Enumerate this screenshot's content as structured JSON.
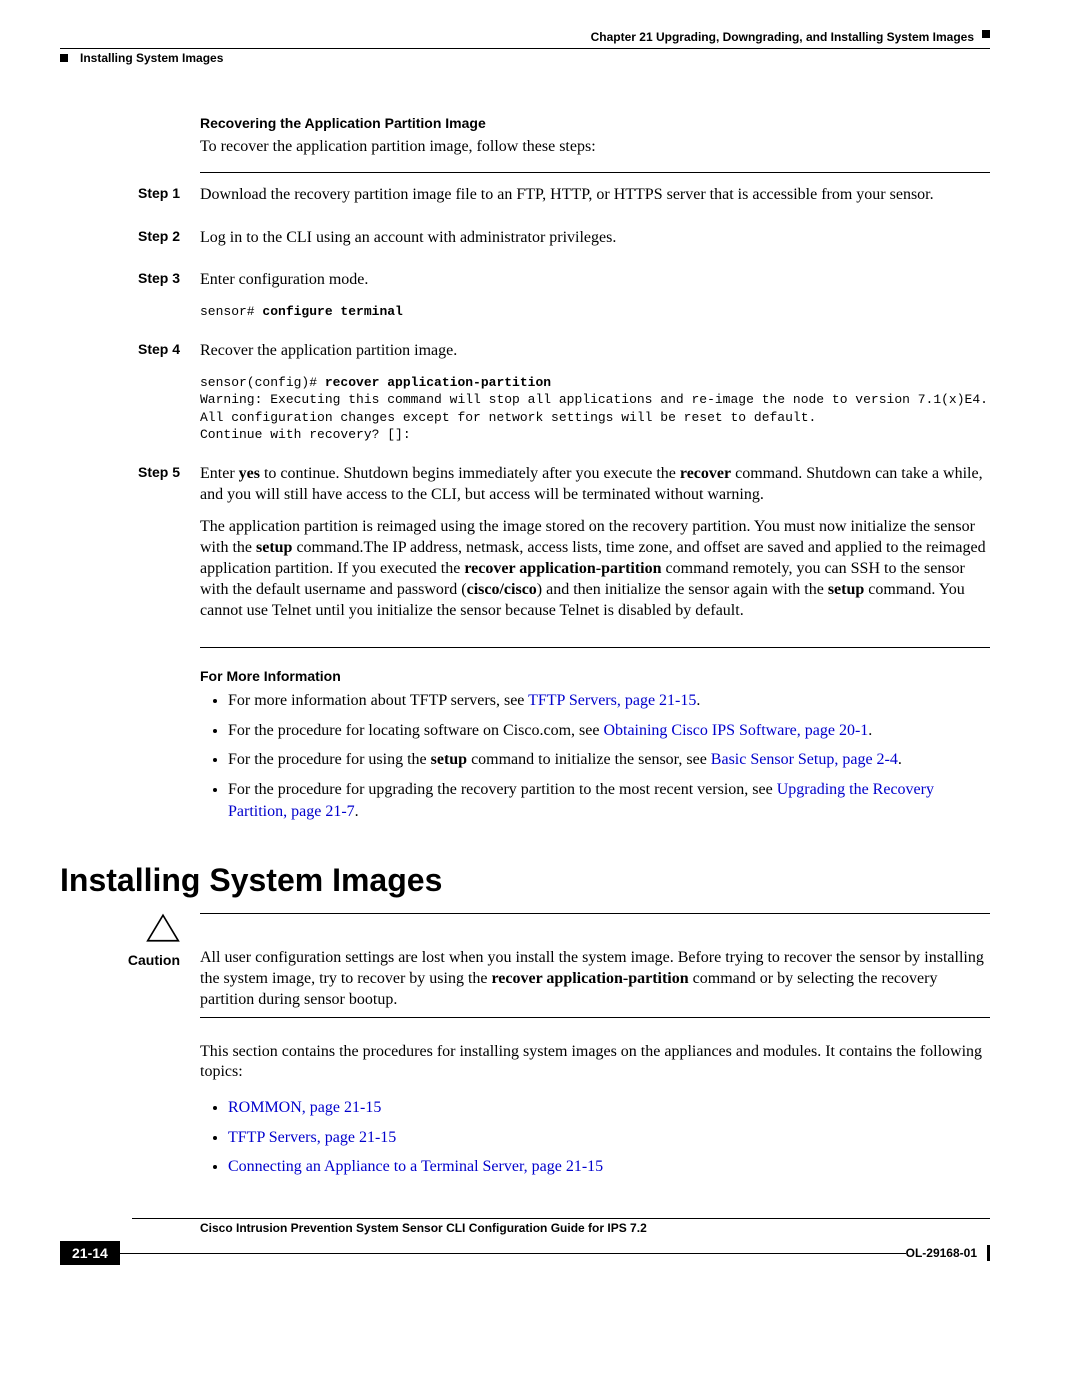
{
  "header": {
    "chapter": "Chapter 21    Upgrading, Downgrading, and Installing System Images",
    "section": "Installing System Images"
  },
  "recovering": {
    "heading": "Recovering the Application Partition Image",
    "intro": "To recover the application partition image, follow these steps:",
    "steps": {
      "s1": {
        "label": "Step 1",
        "text": "Download the recovery partition image file to an FTP, HTTP, or HTTPS server that is accessible from your sensor."
      },
      "s2": {
        "label": "Step 2",
        "text": "Log in to the CLI using an account with administrator privileges."
      },
      "s3": {
        "label": "Step 3",
        "text": "Enter configuration mode.",
        "code_prefix": "sensor# ",
        "code_bold": "configure terminal"
      },
      "s4": {
        "label": "Step 4",
        "text": "Recover the application partition image.",
        "code_prefix": "sensor(config)# ",
        "code_bold": "recover application-partition",
        "warning": "Warning: Executing this command will stop all applications and re-image the node to version 7.1(x)E4. All configuration changes except for network settings will be reset to default.\nContinue with recovery? []:"
      },
      "s5": {
        "label": "Step 5",
        "p1_pre": "Enter ",
        "p1_b1": "yes",
        "p1_mid1": " to continue. Shutdown begins immediately after you execute the ",
        "p1_b2": "recover",
        "p1_post": " command. Shutdown can take a while, and you will still have access to the CLI, but access will be terminated without warning.",
        "p2_pre": "The application partition is reimaged using the image stored on the recovery partition. You must now initialize the sensor with the ",
        "p2_b1": "setup",
        "p2_mid1": " command.The IP address, netmask, access lists, time zone, and offset are saved and applied to the reimaged application partition. If you executed the ",
        "p2_b2": "recover application-partition",
        "p2_mid2": " command remotely, you can SSH to the sensor with the default username and password (",
        "p2_b3": "cisco/cisco",
        "p2_mid3": ") and then initialize the sensor again with the ",
        "p2_b4": "setup",
        "p2_post": " command. You cannot use Telnet until you initialize the sensor because Telnet is disabled by default."
      }
    }
  },
  "moreinfo": {
    "heading": "For More Information",
    "i1_pre": "For more information about TFTP servers, see ",
    "i1_link": "TFTP Servers, page 21-15",
    "i1_post": ".",
    "i2_pre": "For the procedure for locating software on Cisco.com, see ",
    "i2_link": "Obtaining Cisco IPS Software, page 20-1",
    "i2_post": ".",
    "i3_pre": "For the procedure for using the ",
    "i3_b": "setup",
    "i3_mid": " command to initialize the sensor, see ",
    "i3_link": "Basic Sensor Setup, page 2-4",
    "i3_post": ".",
    "i4_pre": "For the procedure for upgrading the recovery partition to the most recent version, see ",
    "i4_link": "Upgrading the Recovery Partition, page 21-7",
    "i4_post": "."
  },
  "install": {
    "heading": "Installing System Images",
    "caution_label": "Caution",
    "caution_pre": "All user configuration settings are lost when you install the system image. Before trying to recover the sensor by installing the system image, try to recover by using the ",
    "caution_b": "recover application-partition",
    "caution_post": " command or by selecting the recovery partition during sensor bootup.",
    "intro": "This section contains the procedures for installing system images on the appliances and modules. It contains the following topics:",
    "topics": {
      "t1": "ROMMON, page 21-15",
      "t2": "TFTP Servers, page 21-15",
      "t3": "Connecting an Appliance to a Terminal Server, page 21-15"
    }
  },
  "footer": {
    "guide": "Cisco Intrusion Prevention System Sensor CLI Configuration Guide for IPS 7.2",
    "page": "21-14",
    "doc": "OL-29168-01"
  }
}
